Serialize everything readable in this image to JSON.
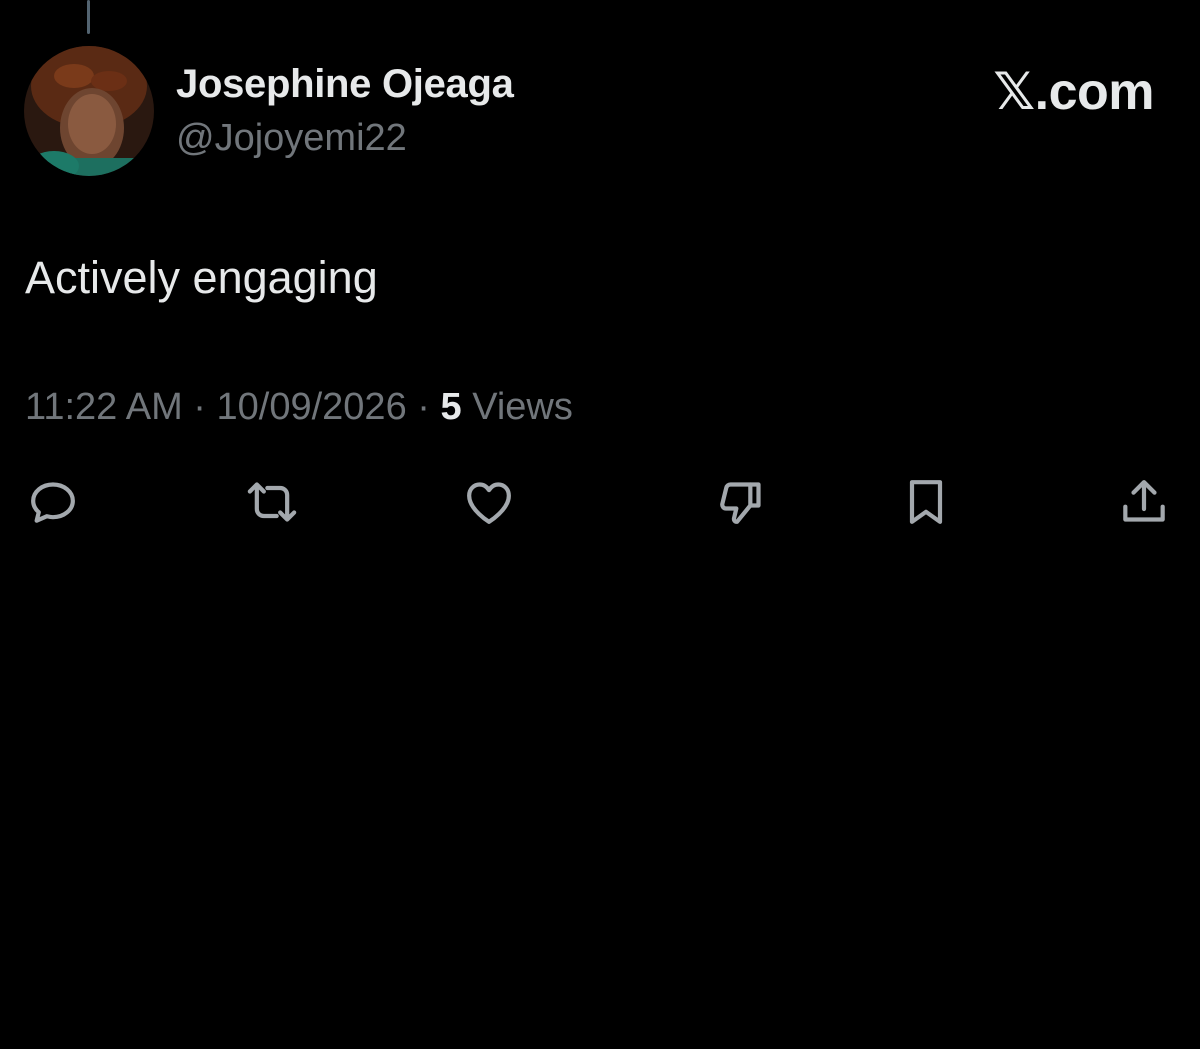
{
  "user": {
    "display_name": "Josephine Ojeaga",
    "handle": "@Jojoyemi22"
  },
  "brand": {
    "label": "𝕏.com"
  },
  "tweet": {
    "text": "Actively engaging",
    "time": "11:22 AM",
    "separator": " · ",
    "date": "10/09/2026",
    "views_count": "5",
    "views_label": "Views"
  },
  "actions": [
    {
      "name": "reply",
      "icon": "reply-icon"
    },
    {
      "name": "retweet",
      "icon": "retweet-icon"
    },
    {
      "name": "like",
      "icon": "heart-icon"
    },
    {
      "name": "dislike",
      "icon": "thumbs-down-icon"
    },
    {
      "name": "bookmark",
      "icon": "bookmark-icon"
    },
    {
      "name": "share",
      "icon": "share-icon"
    }
  ],
  "colors": {
    "background": "#000000",
    "primary_text": "#e7e9ea",
    "secondary_text": "#71767b",
    "icon": "#a3a8ad"
  }
}
